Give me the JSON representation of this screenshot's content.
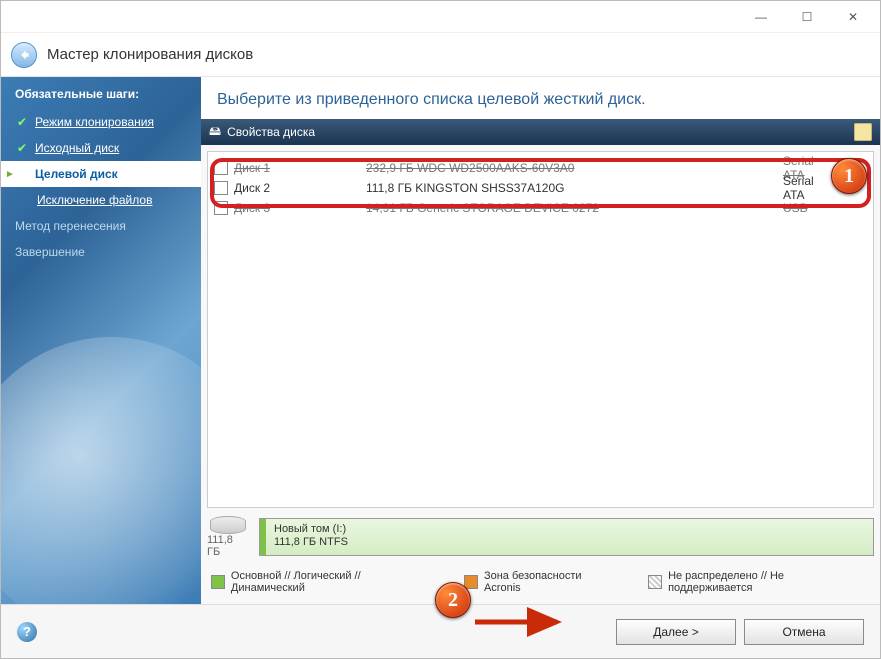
{
  "window": {
    "title": "Мастер клонирования дисков"
  },
  "sidebar": {
    "heading": "Обязательные шаги:",
    "steps": {
      "clone_mode": "Режим клонирования",
      "source_disk": "Исходный диск",
      "target_disk": "Целевой диск",
      "exclude_files": "Исключение файлов",
      "transfer_method": "Метод перенесения",
      "finish": "Завершение"
    }
  },
  "main": {
    "instruction": "Выберите из приведенного списка целевой жесткий диск.",
    "properties_label": "Свойства диска",
    "disks": [
      {
        "name": "Диск 1",
        "capacity": "232,9 ГБ  WDC WD2500AAKS-60V3A0",
        "interface": "Serial ATA",
        "struck": true
      },
      {
        "name": "Диск 2",
        "capacity": "111,8 ГБ  KINGSTON SHSS37A120G",
        "interface": "Serial ATA",
        "struck": false
      },
      {
        "name": "Диск 3",
        "capacity": "14,91 ГБ  Generic STORAGE DEVICE 0272",
        "interface": "USB",
        "struck": true
      }
    ],
    "partition": {
      "total": "111,8 ГБ",
      "volume_label": "Новый том (I:)",
      "volume_desc": "111,8 ГБ  NTFS"
    },
    "legend": {
      "primary": "Основной // Логический // Динамический",
      "acronis": "Зона безопасности Acronis",
      "unalloc": "Не распределено // Не поддерживается"
    }
  },
  "footer": {
    "next": "Далее >",
    "cancel": "Отмена"
  },
  "callouts": {
    "one": "1",
    "two": "2"
  }
}
